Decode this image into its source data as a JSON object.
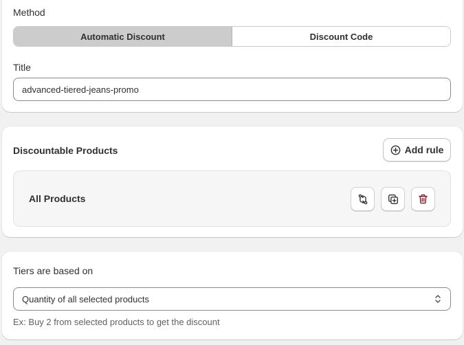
{
  "method": {
    "label": "Method",
    "options": [
      "Automatic Discount",
      "Discount Code"
    ],
    "selected": "Automatic Discount"
  },
  "title_field": {
    "label": "Title",
    "value": "advanced-tiered-jeans-promo"
  },
  "discountable": {
    "heading": "Discountable Products",
    "add_rule_label": "Add rule",
    "product_name": "All Products"
  },
  "tiers": {
    "heading": "Tiers are based on",
    "selected": "Quantity of all selected products",
    "help": "Ex: Buy 2 from selected products to get the discount"
  },
  "colors": {
    "active_segment": "#cccccc",
    "delete_icon": "#8e0b21",
    "text": "#303030"
  }
}
